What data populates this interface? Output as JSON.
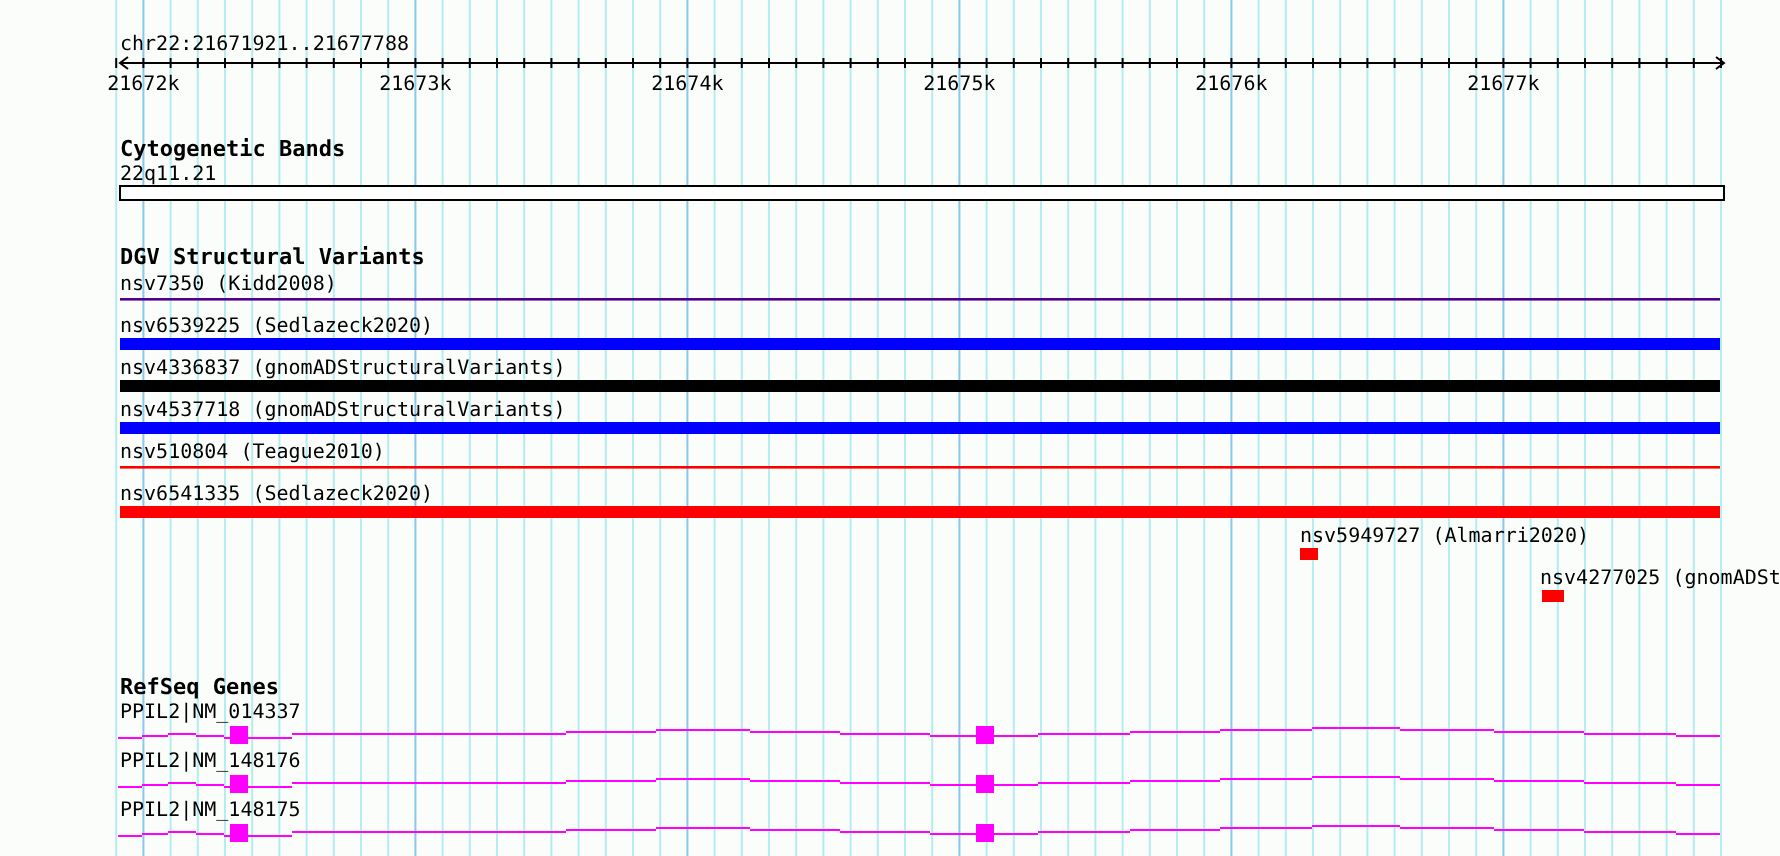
{
  "ruler": {
    "location": "chr22:21671921..21677788",
    "ticks": [
      "21672k",
      "21673k",
      "21674k",
      "21675k",
      "21676k",
      "21677k"
    ]
  },
  "tracks": [
    {
      "title": "Cytogenetic Bands",
      "features": [
        {
          "label": "22q11.21",
          "kind": "band"
        }
      ]
    },
    {
      "title": "DGV Structural Variants",
      "features": [
        {
          "label": "nsv7350 (Kidd2008)",
          "kind": "line",
          "color": "#500090"
        },
        {
          "label": "nsv6539225 (Sedlazeck2020)",
          "kind": "bar",
          "color": "#0000ff"
        },
        {
          "label": "nsv4336837 (gnomADStructuralVariants)",
          "kind": "bar",
          "color": "#000000"
        },
        {
          "label": "nsv4537718 (gnomADStructuralVariants)",
          "kind": "bar",
          "color": "#0000ff"
        },
        {
          "label": "nsv510804 (Teague2010)",
          "kind": "line",
          "color": "#ff0000"
        },
        {
          "label": "nsv6541335 (Sedlazeck2020)",
          "kind": "bar",
          "color": "#ff0000"
        },
        {
          "label": "nsv5949727 (Almarri2020)",
          "kind": "bar",
          "color": "#ff0000"
        },
        {
          "label": "nsv4277025 (gnomADSt",
          "kind": "bar",
          "color": "#ff0000"
        }
      ]
    },
    {
      "title": "RefSeq Genes",
      "features": [
        {
          "label": "PPIL2|NM_014337",
          "kind": "gene"
        },
        {
          "label": "PPIL2|NM_148176",
          "kind": "gene"
        },
        {
          "label": "PPIL2|NM_148175",
          "kind": "gene"
        }
      ]
    }
  ]
}
